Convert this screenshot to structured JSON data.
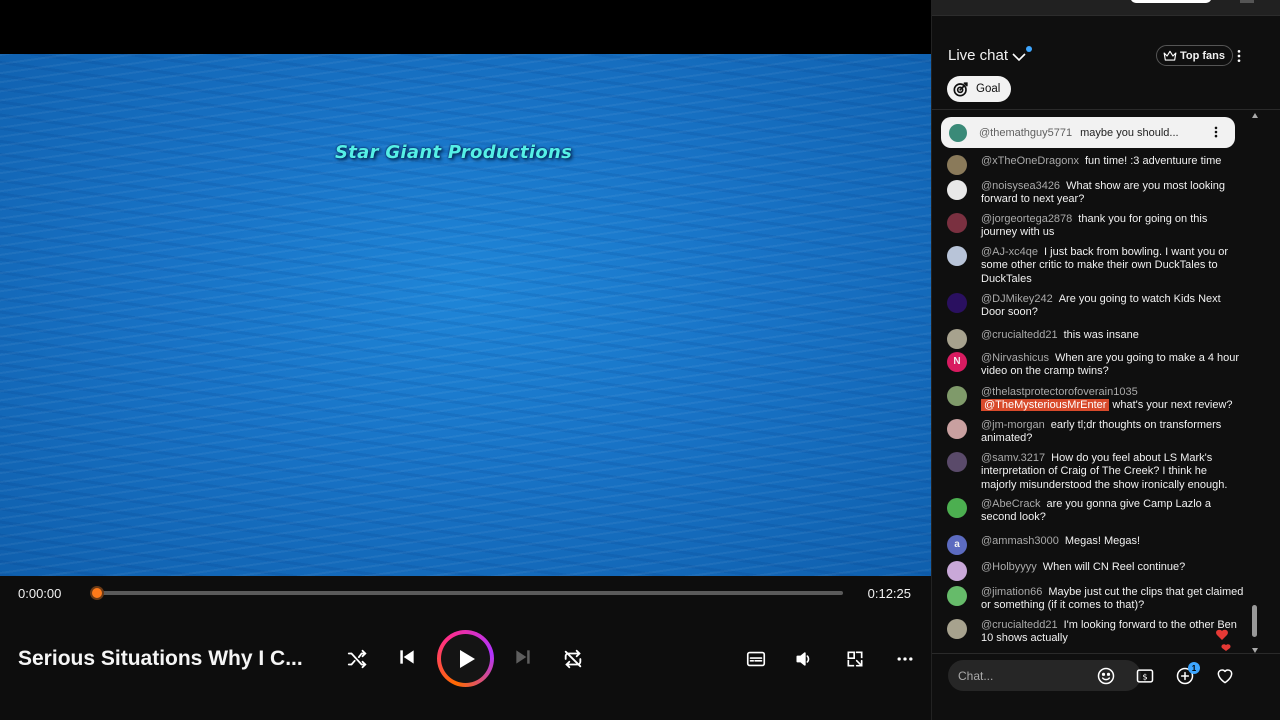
{
  "player": {
    "overlay_title": "Star Giant Productions",
    "time_current": "0:00:00",
    "time_total": "0:12:25",
    "progress_fraction": 0.0,
    "now_playing_title": "Serious Situations Why I C...",
    "icons": {
      "shuffle": "shuffle-icon",
      "previous": "skip-previous-icon",
      "play": "play-icon",
      "next": "skip-next-icon",
      "repeat": "repeat-off-icon",
      "captions": "captions-icon",
      "volume": "volume-icon",
      "miniplayer": "miniplayer-icon",
      "more": "more-horizontal-icon"
    },
    "accent_colors": [
      "#ff6a00",
      "#ff2d8a",
      "#b033ff"
    ]
  },
  "chat": {
    "header_title": "Live chat",
    "top_fans_label": "Top fans",
    "goal_label": "Goal",
    "pinned": {
      "author": "@themathguy5771",
      "message": "maybe you should..."
    },
    "messages": [
      {
        "author": "@xTheOneDragonx",
        "text": "fun time! :3 adventuure time",
        "avatar_color": "#8a7a5a"
      },
      {
        "author": "@noisysea3426",
        "text": "What show are you most looking forward to next year?",
        "avatar_color": "#e8e8e8"
      },
      {
        "author": "@jorgeortega2878",
        "text": "thank you for going on this journey with us",
        "avatar_color": "#7a3040"
      },
      {
        "author": "@AJ-xc4qe",
        "text": "I just back from bowling. I want you or some other critic to make their own DuckTales to DuckTales",
        "avatar_color": "#b8c4d8"
      },
      {
        "author": "@DJMikey242",
        "text": "Are you going to watch Kids Next Door soon?",
        "avatar_color": "#2a1060"
      },
      {
        "author": "@crucialtedd21",
        "text": "this was insane",
        "avatar_color": "#a7a28e"
      },
      {
        "author": "@Nirvashicus",
        "text": "When are you going to make a 4 hour video on the cramp twins?",
        "avatar_color": "#d81b60",
        "initial": "N"
      },
      {
        "author": "@thelastprotectorofoverain1035",
        "mention": "@TheMysteriousMrEnter",
        "text": "what's your next review?",
        "avatar_color": "#7f9a6a"
      },
      {
        "author": "@jm-morgan",
        "text": "early tl;dr thoughts on transformers animated?",
        "avatar_color": "#c9a0a0"
      },
      {
        "author": "@samv.3217",
        "text": "How do you feel about LS Mark's interpretation of Craig of The Creek? I think he majorly misunderstood the show ironically enough.",
        "avatar_color": "#5a4a6a"
      },
      {
        "author": "@AbeCrack",
        "text": "are you gonna give Camp Lazlo a second look?",
        "avatar_color": "#4caf50"
      },
      {
        "author": "@ammash3000",
        "text": "Megas! Megas!",
        "avatar_color": "#5c6bc0",
        "initial": "a"
      },
      {
        "author": "@Holbyyyy",
        "text": "When will CN Reel continue?",
        "avatar_color": "#c9a8d8"
      },
      {
        "author": "@jimation66",
        "text": "Maybe just cut the clips that get claimed or something (if it comes to that)?",
        "avatar_color": "#66bb6a"
      },
      {
        "author": "@crucialtedd21",
        "text": "I'm looking forward to the other Ben 10 shows actually",
        "avatar_color": "#a7a28e"
      }
    ],
    "input_placeholder": "Chat...",
    "notification_badge": "1",
    "icons": {
      "emoji": "emoji-icon",
      "super_chat": "super-chat-icon",
      "add": "add-icon",
      "like": "heart-icon",
      "more": "more-vertical-icon",
      "goal": "goal-icon",
      "crown": "crown-icon"
    }
  }
}
